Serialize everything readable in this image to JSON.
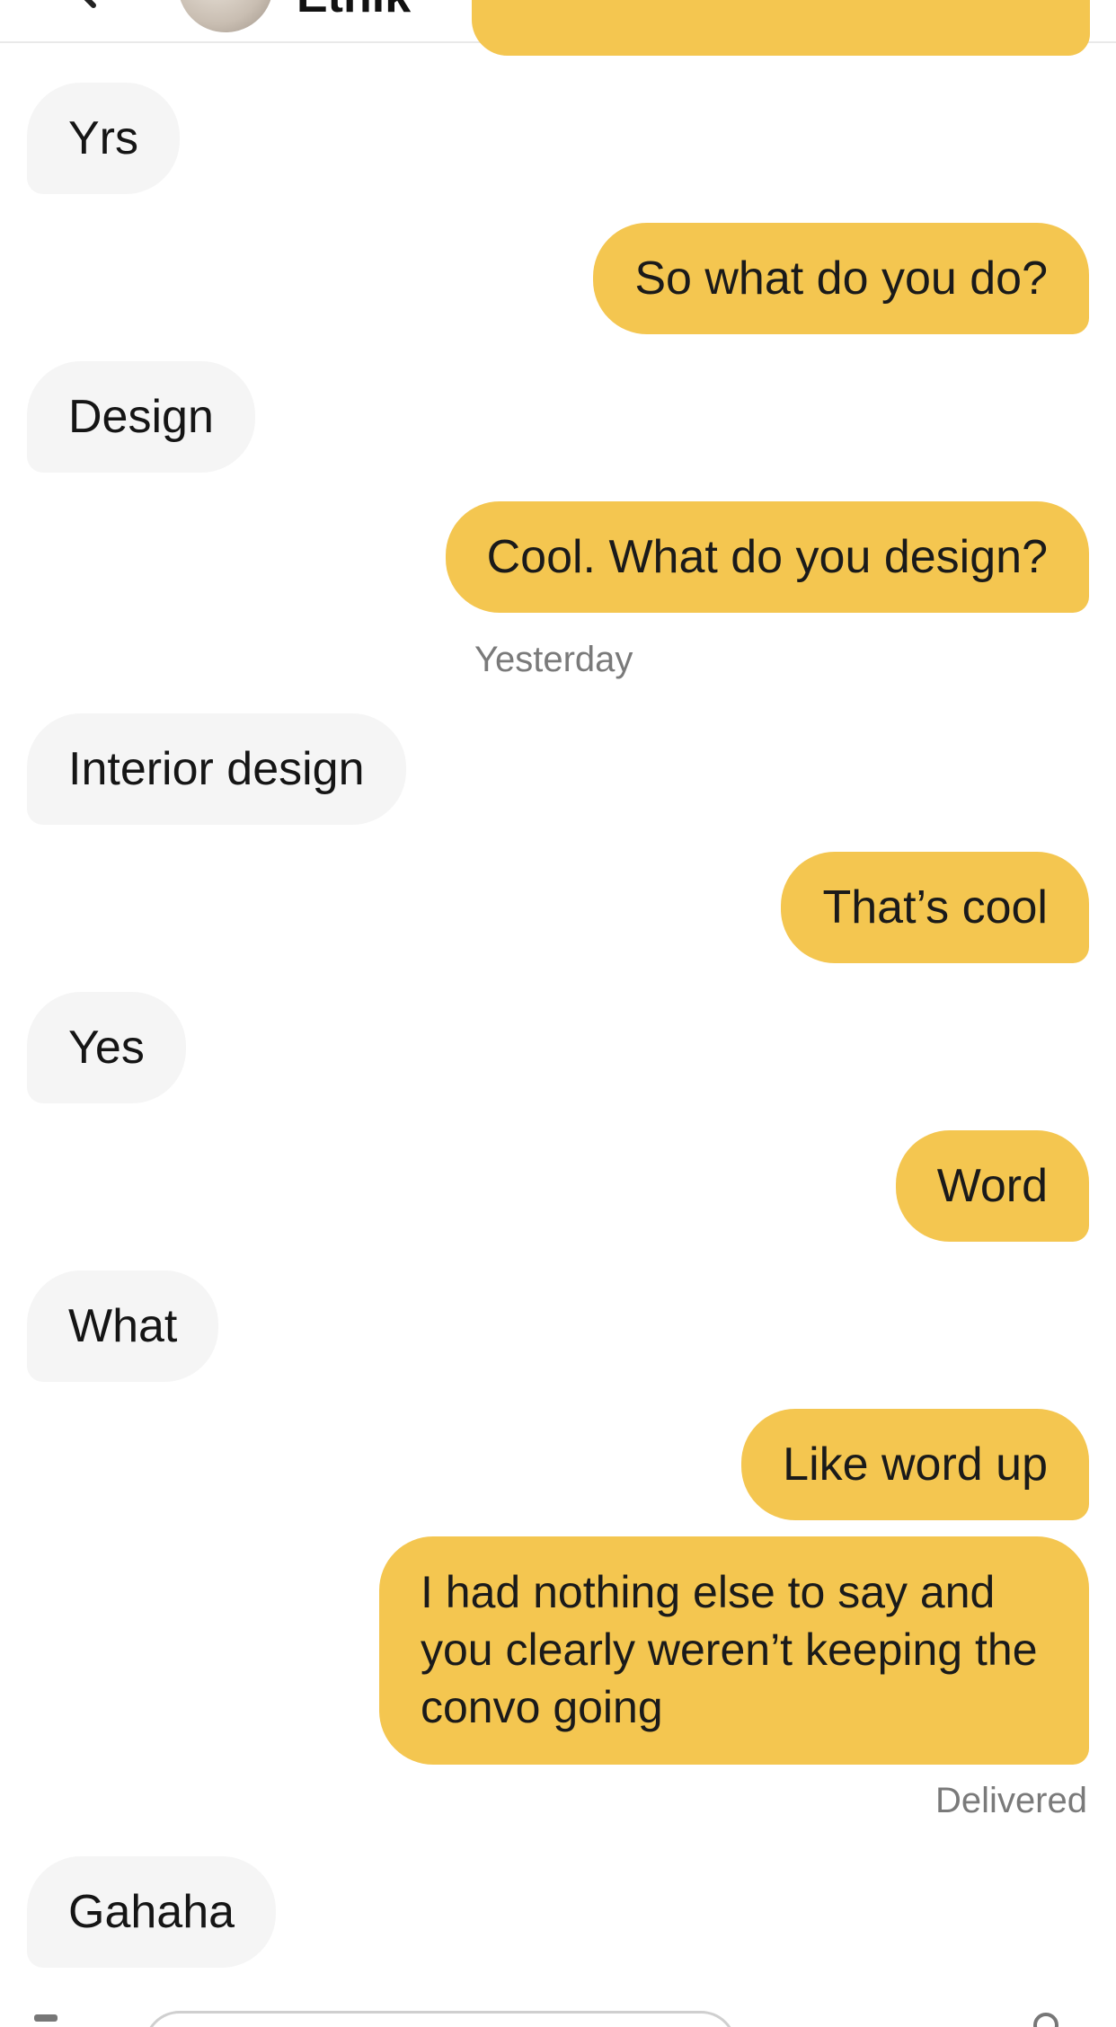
{
  "header": {
    "contact_name": "Ethik",
    "icons": [
      "back-arrow-icon",
      "video-call-icon",
      "report-icon",
      "more-options-icon"
    ]
  },
  "messages": [
    {
      "side": "in",
      "text": "Yrs"
    },
    {
      "side": "out",
      "text": "So what do you do?"
    },
    {
      "side": "in",
      "text": "Design"
    },
    {
      "side": "out",
      "text": "Cool. What do you design?"
    },
    {
      "side": "in",
      "text": "Interior design"
    },
    {
      "side": "out",
      "text": "That’s cool"
    },
    {
      "side": "in",
      "text": "Yes"
    },
    {
      "side": "out",
      "text": "Word"
    },
    {
      "side": "in",
      "text": "What"
    },
    {
      "side": "out",
      "text": "Like word up"
    },
    {
      "side": "out",
      "text": "I had nothing else to say and you clearly weren’t keeping the convo going"
    },
    {
      "side": "in",
      "text": "Gahaha"
    }
  ],
  "timestamp_label": "Yesterday",
  "status_label": "Delivered",
  "colors": {
    "outgoing_bubble": "#f4c650",
    "incoming_bubble": "#f5f5f5",
    "meta_text": "#7a7a7a"
  }
}
